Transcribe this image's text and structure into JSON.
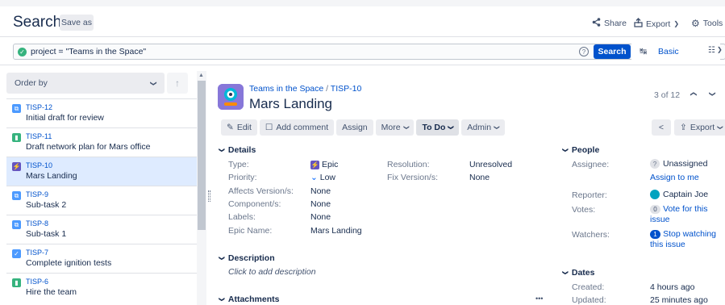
{
  "header": {
    "title": "Search",
    "save_as": "Save as",
    "share": "Share",
    "export": "Export",
    "tools": "Tools"
  },
  "jql": {
    "query": "project = \"Teams in the Space\"",
    "search_label": "Search",
    "basic_label": "Basic"
  },
  "list": {
    "order_by": "Order by",
    "items": [
      {
        "key": "TISP-12",
        "summary": "Initial draft for review",
        "type": "subtask",
        "color": "#4c9aff"
      },
      {
        "key": "TISP-11",
        "summary": "Draft network plan for Mars office",
        "type": "story",
        "color": "#36b37e"
      },
      {
        "key": "TISP-10",
        "summary": "Mars Landing",
        "type": "epic",
        "color": "#6554c0"
      },
      {
        "key": "TISP-9",
        "summary": "Sub-task 2",
        "type": "subtask",
        "color": "#4c9aff"
      },
      {
        "key": "TISP-8",
        "summary": "Sub-task 1",
        "type": "subtask",
        "color": "#4c9aff"
      },
      {
        "key": "TISP-7",
        "summary": "Complete ignition tests",
        "type": "task",
        "color": "#4c9aff"
      },
      {
        "key": "TISP-6",
        "summary": "Hire the team",
        "type": "story",
        "color": "#36b37e"
      }
    ]
  },
  "issue": {
    "project": "Teams in the Space",
    "separator": "/",
    "key": "TISP-10",
    "title": "Mars Landing",
    "pager": "3 of 12",
    "ops": {
      "edit": "Edit",
      "add_comment": "Add comment",
      "assign": "Assign",
      "more": "More",
      "status": "To Do",
      "admin": "Admin",
      "export": "Export"
    },
    "details": {
      "heading": "Details",
      "type_label": "Type:",
      "type_value": "Epic",
      "priority_label": "Priority:",
      "priority_value": "Low",
      "affects_label": "Affects Version/s:",
      "affects_value": "None",
      "component_label": "Component/s:",
      "component_value": "None",
      "labels_label": "Labels:",
      "labels_value": "None",
      "epic_name_label": "Epic Name:",
      "epic_name_value": "Mars Landing",
      "resolution_label": "Resolution:",
      "resolution_value": "Unresolved",
      "fix_label": "Fix Version/s:",
      "fix_value": "None"
    },
    "description": {
      "heading": "Description",
      "placeholder": "Click to add description"
    },
    "attachments": {
      "heading": "Attachments",
      "more": "•••"
    },
    "people": {
      "heading": "People",
      "assignee_label": "Assignee:",
      "assignee_value": "Unassigned",
      "assign_to_me": "Assign to me",
      "reporter_label": "Reporter:",
      "reporter_value": "Captain Joe",
      "votes_label": "Votes:",
      "votes_count": "0",
      "vote_link": "Vote for this issue",
      "watchers_label": "Watchers:",
      "watchers_count": "1",
      "watch_link": "Stop watching this issue"
    },
    "dates": {
      "heading": "Dates",
      "created_label": "Created:",
      "created_value": "4 hours ago",
      "updated_label": "Updated:",
      "updated_value": "25 minutes ago"
    }
  }
}
